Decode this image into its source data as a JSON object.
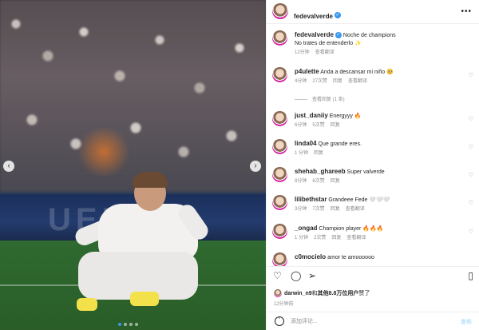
{
  "post": {
    "username": "fedevalverde",
    "verified": true,
    "caption_line1": "Noche de champions",
    "caption_line2": "No trates de entenderlo ✨",
    "time": "12分钟",
    "translate": "查看翻译"
  },
  "photo": {
    "ad_text": "UEFA",
    "slide_count": 4,
    "active_slide": 1
  },
  "comments": [
    {
      "username": "p4ulette",
      "text": "Anda a descansar mi niño 🥺",
      "time": "4分钟",
      "likes": "27次赞",
      "reply": "回复",
      "translate": "查看翻译",
      "view_replies": "查看回复 (1 条)"
    },
    {
      "username": "just_daniiy",
      "text": "Energyyy 🔥",
      "time": "6分钟",
      "likes": "5次赞",
      "reply": "回复"
    },
    {
      "username": "linda04",
      "text": "Que grande eres.",
      "time": "1 分钟",
      "reply": "回复"
    },
    {
      "username": "shehab_ghareeb",
      "text": "Super valverde",
      "time": "8分钟",
      "likes": "6次赞",
      "reply": "回复"
    },
    {
      "username": "lilibethstar",
      "text": "Grandeee Fede 🤍🤍🤍",
      "time": "3分钟",
      "likes": "7次赞",
      "reply": "回复",
      "translate": "查看翻译"
    },
    {
      "username": "_ongad",
      "text": "Champion player 🔥🔥🔥",
      "time": "1 分钟",
      "likes": "2次赞",
      "reply": "回复",
      "translate": "查看翻译"
    },
    {
      "username": "c0mocielo",
      "text": "amor te amoooooo"
    }
  ],
  "likes": {
    "liker": "darwin_n9",
    "joiner": "和",
    "others": "其他8.8万位用户",
    "suffix": "赞了"
  },
  "post_time": "12分钟前",
  "composer": {
    "placeholder": "添加评论...",
    "post_label": "发布"
  }
}
